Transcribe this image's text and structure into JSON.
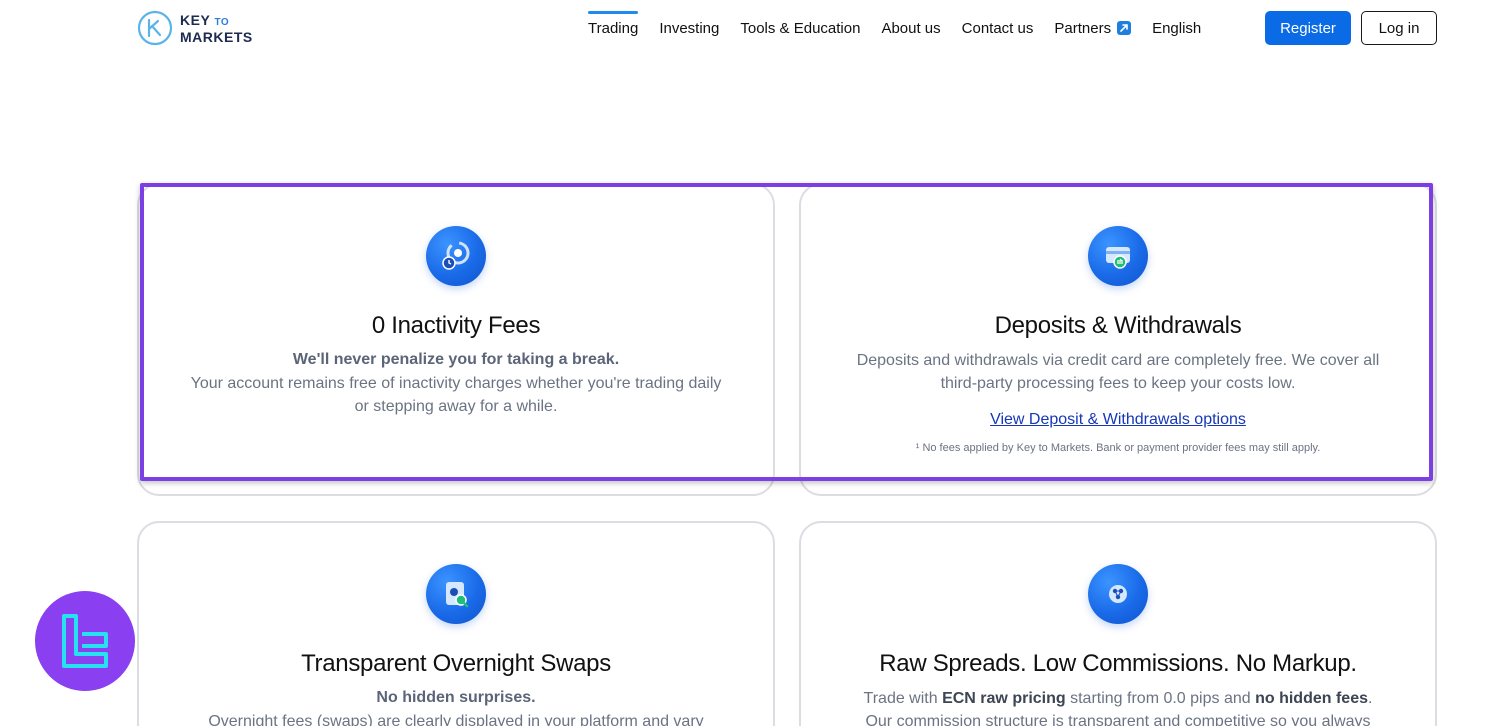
{
  "brand": {
    "line1": "KEY",
    "to": "TO",
    "line2": "MARKETS"
  },
  "nav": {
    "items": [
      {
        "label": "Trading",
        "active": true
      },
      {
        "label": "Investing"
      },
      {
        "label": "Tools & Education"
      },
      {
        "label": "About us"
      },
      {
        "label": "Contact us"
      },
      {
        "label": "Partners",
        "external": true
      },
      {
        "label": "English"
      }
    ],
    "register": "Register",
    "login": "Log in"
  },
  "cards": [
    {
      "icon": "pie-chart-clock-icon",
      "title": "0 Inactivity Fees",
      "subtitle": "We'll never penalize you for taking a break.",
      "body": "Your account remains free of inactivity charges whether you're trading daily or stepping away for a while."
    },
    {
      "icon": "credit-card-exchange-icon",
      "title": "Deposits & Withdrawals",
      "body": "Deposits and withdrawals via credit card are completely free. We cover all third-party processing fees to keep your costs low.",
      "link": "View Deposit & Withdrawals options",
      "note": "¹ No fees applied by Key to Markets. Bank or payment provider fees may still apply."
    },
    {
      "icon": "document-search-icon",
      "title": "Transparent Overnight Swaps",
      "subtitle": "No hidden surprises.",
      "body": "Overnight fees (swaps) are clearly displayed in your platform and vary"
    },
    {
      "icon": "network-nodes-icon",
      "title": "Raw Spreads. Low Commissions. No Markup.",
      "body_parts": [
        "Trade with ",
        "ECN raw pricing",
        " starting from 0.0 pips and ",
        "no hidden fees",
        "."
      ],
      "body2": "Our commission structure is transparent and competitive so you always"
    }
  ],
  "colors": {
    "accent": "#0b6be6",
    "highlight": "#7b3fe4",
    "badge": "#8a3ff0"
  }
}
